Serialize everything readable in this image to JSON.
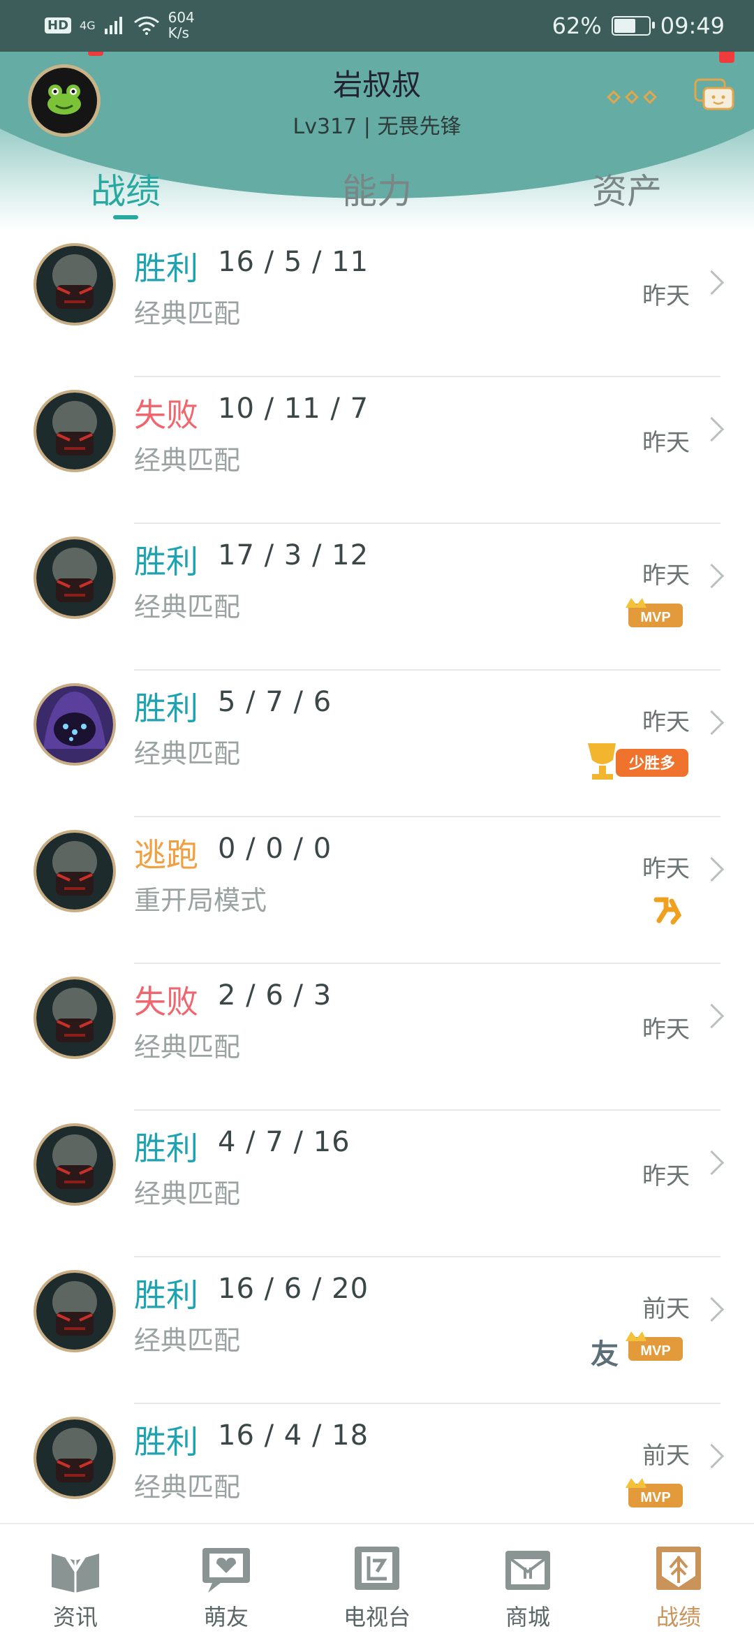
{
  "status_bar": {
    "hd": "HD",
    "net": "4G",
    "speed_value": "604",
    "speed_unit": "K/s",
    "battery": "62%",
    "battery_level": 0.62,
    "time": "09:49"
  },
  "header": {
    "username": "岩叔叔",
    "level": "Lv317 | 无畏先锋"
  },
  "tabs": [
    {
      "label": "战绩",
      "active": true
    },
    {
      "label": "能力",
      "active": false
    },
    {
      "label": "资产",
      "active": false
    }
  ],
  "matches": [
    {
      "result": "胜利",
      "kda": "16 / 5 / 11",
      "mode": "经典匹配",
      "when": "昨天",
      "badges": []
    },
    {
      "result": "失败",
      "kda": "10 / 11 / 7",
      "mode": "经典匹配",
      "when": "昨天",
      "badges": []
    },
    {
      "result": "胜利",
      "kda": "17 / 3 / 12",
      "mode": "经典匹配",
      "when": "昨天",
      "badges": [
        "MVP"
      ]
    },
    {
      "result": "胜利",
      "kda": "5 / 7 / 6",
      "mode": "经典匹配",
      "when": "昨天",
      "badges": [
        "少胜多"
      ]
    },
    {
      "result": "逃跑",
      "kda": "0 / 0 / 0",
      "mode": "重开局模式",
      "when": "昨天",
      "badges": [
        "flee"
      ]
    },
    {
      "result": "失败",
      "kda": "2 / 6 / 3",
      "mode": "经典匹配",
      "when": "昨天",
      "badges": []
    },
    {
      "result": "胜利",
      "kda": "4 / 7 / 16",
      "mode": "经典匹配",
      "when": "昨天",
      "badges": []
    },
    {
      "result": "胜利",
      "kda": "16 / 6 / 20",
      "mode": "经典匹配",
      "when": "前天",
      "badges": [
        "友",
        "MVP"
      ]
    },
    {
      "result": "胜利",
      "kda": "16 / 4 / 18",
      "mode": "经典匹配",
      "when": "前天",
      "badges": [
        "MVP"
      ]
    }
  ],
  "badge_text": {
    "mvp": "MVP",
    "few_win": "少胜多",
    "friend": "友"
  },
  "bottom_nav": [
    {
      "label": "资讯",
      "icon": "book-icon"
    },
    {
      "label": "萌友",
      "icon": "heart-chat-icon"
    },
    {
      "label": "电视台",
      "icon": "tv-icon"
    },
    {
      "label": "商城",
      "icon": "shop-bag-icon"
    },
    {
      "label": "战绩",
      "icon": "record-shield-icon",
      "active": true
    }
  ],
  "colors": {
    "accent": "#29a8a0",
    "win": "#1fa3b1",
    "lose": "#f0666f",
    "escape": "#f0a040",
    "nav_active": "#c9935a",
    "header_bg": "#65aca5"
  }
}
